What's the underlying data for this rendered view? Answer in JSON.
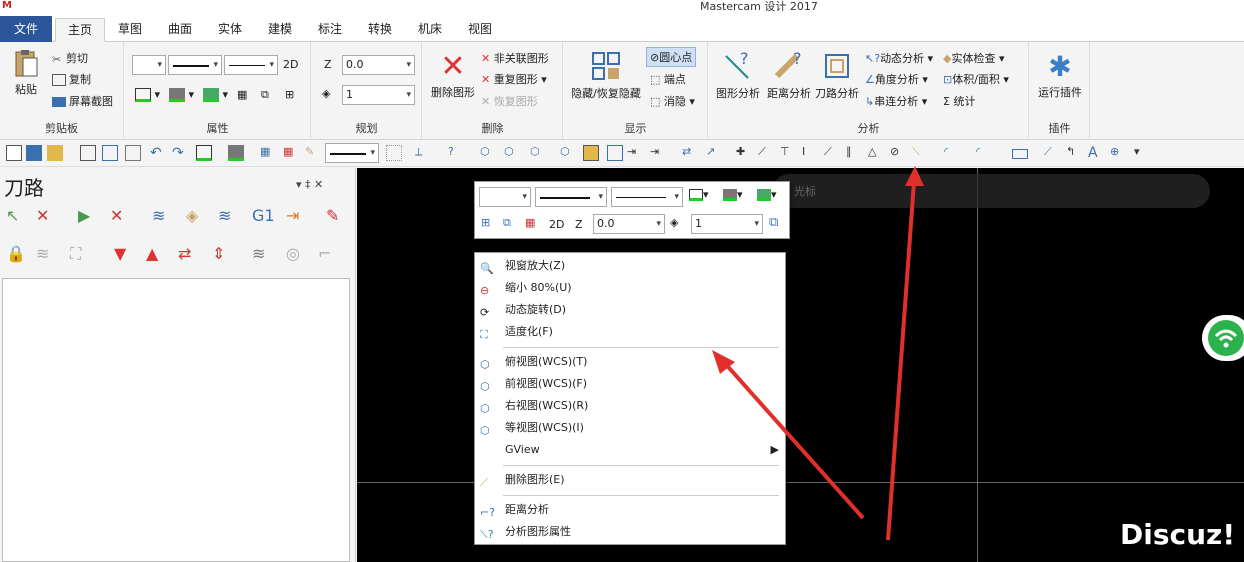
{
  "window": {
    "title": "Mastercam 设计 2017"
  },
  "tabs": [
    "文件",
    "主页",
    "草图",
    "曲面",
    "实体",
    "建模",
    "标注",
    "转换",
    "机床",
    "视图"
  ],
  "ribbon": {
    "clipboard": {
      "label": "剪贴板",
      "paste": "粘贴",
      "cut": "剪切",
      "copy": "复制",
      "screenshot": "屏幕截图"
    },
    "attributes": {
      "label": "属性",
      "mode_2d": "2D"
    },
    "planning": {
      "label": "规划",
      "z_label": "Z",
      "z_value": "0.0",
      "level_value": "1"
    },
    "delete": {
      "label": "删除",
      "delete_entity": "删除图形",
      "unrelated": "非关联图形",
      "duplicate": "重复图形",
      "restore": "恢复图形"
    },
    "display": {
      "label": "显示",
      "hide_restore": "隐藏/恢复隐藏",
      "center_point": "圆心点",
      "endpoint": "端点",
      "blank": "消隐"
    },
    "analysis": {
      "label": "分析",
      "analyze_entity": "图形分析",
      "distance": "距离分析",
      "toolpath": "刀路分析",
      "dynamic": "动态分析",
      "angle": "角度分析",
      "chain": "串连分析",
      "solid_check": "实体检查",
      "volume_area": "体积/面积",
      "statistics": "统计"
    },
    "addins": {
      "label": "插件",
      "run_addin": "运行插件"
    }
  },
  "panel": {
    "title": "刀路",
    "controls": "▾  ‡  ✕"
  },
  "ghost_toolbar": {
    "text": "光标"
  },
  "mini_toolbar": {
    "mode_2d": "2D",
    "z_label": "Z",
    "z_value": "0.0",
    "level_value": "1"
  },
  "context_menu": {
    "items": [
      {
        "label": "视窗放大(Z)",
        "icon": "zoom-window-icon"
      },
      {
        "label": "缩小 80%(U)",
        "icon": "zoom-out-icon"
      },
      {
        "label": "动态旋转(D)",
        "icon": "dynamic-rotate-icon"
      },
      {
        "label": "适度化(F)",
        "icon": "fit-icon"
      },
      {
        "label": "俯视图(WCS)(T)",
        "icon": "top-view-icon"
      },
      {
        "label": "前视图(WCS)(F)",
        "icon": "front-view-icon"
      },
      {
        "label": "右视图(WCS)(R)",
        "icon": "right-view-icon"
      },
      {
        "label": "等视图(WCS)(I)",
        "icon": "iso-view-icon"
      },
      {
        "label": "GView",
        "icon": ""
      },
      {
        "label": "删除图形(E)",
        "icon": "delete-entity-icon"
      },
      {
        "label": "距离分析",
        "icon": "distance-analysis-icon"
      },
      {
        "label": "分析图形属性",
        "icon": "analyze-entity-icon"
      }
    ]
  },
  "watermark": "Discuz!",
  "colors": {
    "file_tab": "#2b579a",
    "accent_red": "#e0302a",
    "wifi_green": "#2bb24c",
    "canvas": "#000000"
  }
}
